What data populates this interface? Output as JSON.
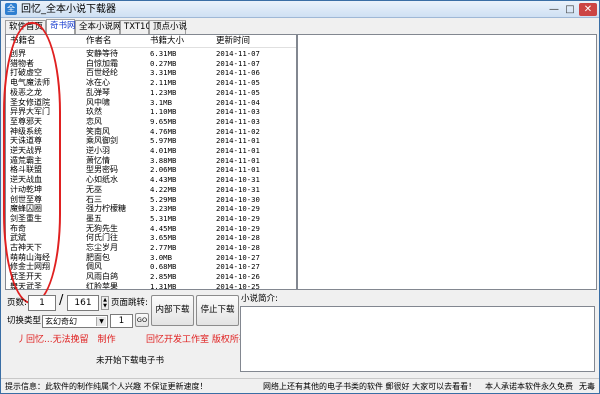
{
  "window": {
    "title": "回忆_全本小说下载器",
    "app_icon_char": "全"
  },
  "controls": {
    "minimize": "—",
    "maximize": "□",
    "close": "✕"
  },
  "tabs": [
    {
      "label": "软件首页"
    },
    {
      "label": "奇书网"
    },
    {
      "label": "全本小说网"
    },
    {
      "label": "TXT100"
    },
    {
      "label": "顶点小说"
    }
  ],
  "table": {
    "columns": [
      "书籍名",
      "作者名",
      "书籍大小",
      "更新时间"
    ],
    "rows": [
      [
        "创界",
        "安静等待",
        "6.31MB",
        "2014-11-07"
      ],
      [
        "猎物者",
        "白惊加霜",
        "0.27MB",
        "2014-11-07"
      ],
      [
        "打破虚空",
        "百世经纶",
        "3.31MB",
        "2014-11-06"
      ],
      [
        "电气魔法师",
        "冰在心",
        "2.11MB",
        "2014-11-05"
      ],
      [
        "极恶之龙",
        "乱弹琴",
        "1.23MB",
        "2014-11-05"
      ],
      [
        "圣女修道院",
        "风中啸",
        "3.1MB",
        "2014-11-04"
      ],
      [
        "异界大军门",
        "玖然",
        "1.10MB",
        "2014-11-03"
      ],
      [
        "至尊邪天",
        "恋风",
        "9.65MB",
        "2014-11-03"
      ],
      [
        "神级系统",
        "笑南风",
        "4.76MB",
        "2014-11-02"
      ],
      [
        "天诛道尊",
        "乘风御剑",
        "5.97MB",
        "2014-11-01"
      ],
      [
        "逆天战界",
        "逆小羽",
        "4.01MB",
        "2014-11-01"
      ],
      [
        "遁荒霸主",
        "萧忆情",
        "3.88MB",
        "2014-11-01"
      ],
      [
        "格斗联盟",
        "型男密码",
        "2.06MB",
        "2014-11-01"
      ],
      [
        "逆天战血",
        "心如纸水",
        "4.43MB",
        "2014-10-31"
      ],
      [
        "计动乾坤",
        "无巫",
        "4.22MB",
        "2014-10-31"
      ],
      [
        "创世至尊",
        "石三",
        "5.29MB",
        "2014-10-30"
      ],
      [
        "魔蜂囚圈",
        "强力柠檬糖",
        "3.23MB",
        "2014-10-29"
      ],
      [
        "剑圣重生",
        "墨五",
        "5.31MB",
        "2014-10-29"
      ],
      [
        "布奇",
        "无狗先生",
        "4.45MB",
        "2014-10-29"
      ],
      [
        "武斌",
        "何氏门往",
        "3.65MB",
        "2014-10-28"
      ],
      [
        "古神天下",
        "忘尘岁月",
        "2.77MB",
        "2014-10-28"
      ],
      [
        "萌萌山海经",
        "肥面包",
        "3.0MB",
        "2014-10-27"
      ],
      [
        "修金士网翔",
        "倜风",
        "0.68MB",
        "2014-10-27"
      ],
      [
        "武圣开天",
        "风雨白鸽",
        "2.85MB",
        "2014-10-26"
      ],
      [
        "舞天武圣",
        "红脸苹果",
        "1.31MB",
        "2014-10-25"
      ]
    ]
  },
  "pager": {
    "label_page": "页数:",
    "current_page": "1",
    "separator": "/",
    "total_pages": "161",
    "label_jump": "页面跳转:",
    "spin_up": "▲",
    "spin_down": "▼"
  },
  "switch": {
    "label": "切换类型:",
    "selected": "玄幻奇幻",
    "dropdown_arrow": "▼",
    "page_value": "1",
    "go_label": "GO"
  },
  "buttons": {
    "download_inner": "内部下载",
    "stop_download": "停止下载"
  },
  "credits": {
    "left": "丿回忆...无法挽留　制作",
    "right": "回忆开发工作室  版权所有"
  },
  "status_download": "未开始下载电子书",
  "intro_label": "小说简介:",
  "statusbar": {
    "info": "提示信息：此软件的制作纯属个人兴趣 不保证更新速度！",
    "msg2": "网络上还有其他的电子书类的软件 郵很好 大家可以去看看！",
    "msg3": "本人承诺本软件永久免费",
    "msg4": "无毒"
  },
  "colors": {
    "accent": "#1a3fd0",
    "highlight_red": "#e02020",
    "border": "#828790"
  }
}
